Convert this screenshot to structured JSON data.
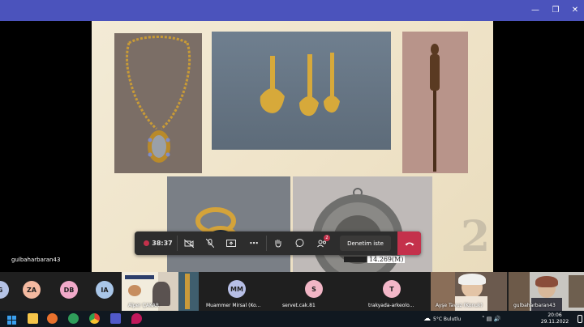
{
  "window": {
    "minimize_icon": "minimize-icon",
    "maximize_icon": "restore-icon",
    "close_icon": "close-icon"
  },
  "slide": {
    "page_number": "2",
    "coin_caption": "14.269(M)",
    "photos": [
      "gold-necklace-photo",
      "gold-ornaments-photo",
      "wooden-figure-stick-photo",
      "gold-ring-photo",
      "silver-medallion-photo"
    ]
  },
  "self_view": {
    "name": "gulbaharbaran43"
  },
  "controls": {
    "timer": "38:37",
    "share_label": "Denetim iste",
    "participants_badge": "2"
  },
  "participants": [
    {
      "initials": "G",
      "color": "#b5c3e6"
    },
    {
      "initials": "ZA",
      "color": "#f4b9a0"
    },
    {
      "initials": "DB",
      "color": "#f1a9c9"
    },
    {
      "initials": "IA",
      "color": "#a9c6e8"
    },
    {
      "name": "Alper ÇAKAR"
    },
    {
      "initials": "MM",
      "name": "Muammer Mirsal (Ko...",
      "color": "#b7bfe6"
    },
    {
      "initials": "S",
      "name": "servet.cak.81",
      "color": "#f2b6c6"
    },
    {
      "initials": "T",
      "name": "trakyada-arkeolo...",
      "color": "#f3b7c8"
    },
    {
      "name": "Ayşe Tavuz (Konuk)"
    },
    {
      "name": "gulbaharbaran43"
    }
  ],
  "taskbar": {
    "weather": "5°C  Bulutlu",
    "time": "20:06",
    "date": "29.11.2022"
  },
  "colors": {
    "teams_purple": "#4b53bc",
    "hangup_red": "#c4314b",
    "slide_bg": "#f0e5cb"
  }
}
